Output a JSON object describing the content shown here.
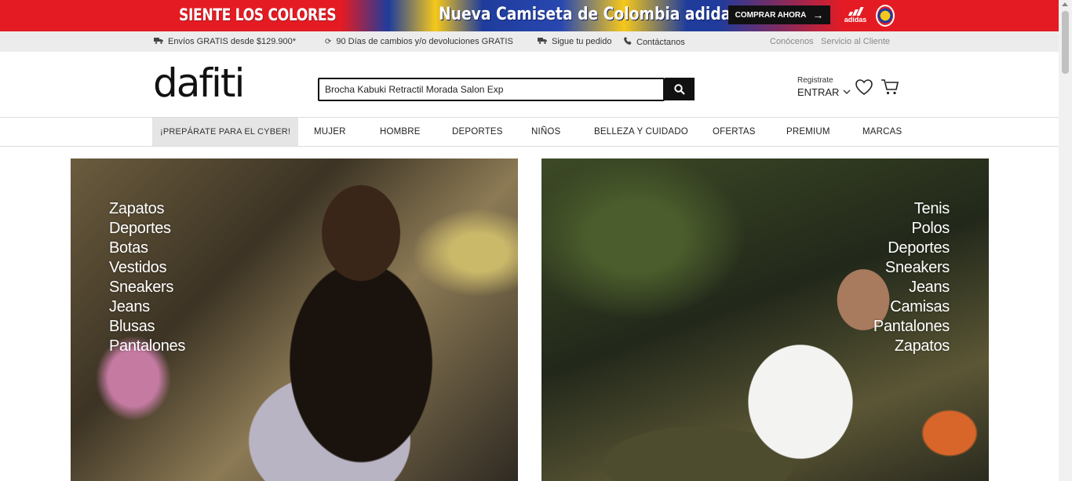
{
  "promo": {
    "left_text": "SIENTE LOS COLORES",
    "center_text": "Nueva Camiseta de Colombia adidas",
    "button_label": "COMPRAR AHORA",
    "brand_label": "adidas",
    "colors": {
      "red": "#e41b23",
      "blue": "#1f3c9c",
      "yellow": "#f6c81b"
    }
  },
  "infobar": {
    "shipping": "Envíos GRATIS desde $129.900*",
    "returns": "90 Días de cambios y/o devoluciones GRATIS",
    "track": "Sigue tu pedido",
    "contact": "Contáctanos",
    "about": "Conócenos",
    "service": "Servicio al Cliente"
  },
  "header": {
    "logo": "dafiti",
    "search_value": "Brocha Kabuki Retractil Morada Salon Exp",
    "register": "Registrate",
    "login": "ENTRAR"
  },
  "nav": {
    "items": [
      "¡PREPÁRATE PARA EL CYBER!",
      "MUJER",
      "HOMBRE",
      "DEPORTES",
      "NIÑOS",
      "BELLEZA Y CUIDADO",
      "OFERTAS",
      "PREMIUM",
      "MARCAS"
    ]
  },
  "hero_women": {
    "categories": [
      "Zapatos",
      "Deportes",
      "Botas",
      "Vestidos",
      "Sneakers",
      "Jeans",
      "Blusas",
      "Pantalones"
    ]
  },
  "hero_men": {
    "categories": [
      "Tenis",
      "Polos",
      "Deportes",
      "Sneakers",
      "Jeans",
      "Camisas",
      "Pantalones",
      "Zapatos"
    ]
  }
}
